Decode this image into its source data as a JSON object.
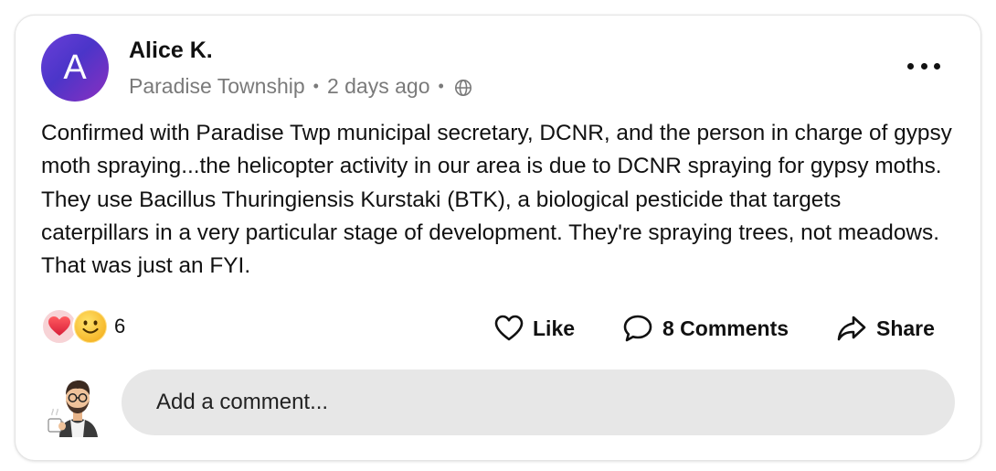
{
  "post": {
    "avatar_letter": "A",
    "author": "Alice K.",
    "location": "Paradise Township",
    "separator": "•",
    "time": "2 days ago",
    "visibility_icon": "globe-icon",
    "menu_icon": "more-horizontal-icon",
    "text": "Confirmed with Paradise Twp municipal secretary, DCNR, and the person in charge of gypsy moth spraying...the helicopter activity in our area is due to DCNR spraying for gypsy moths. They use Bacillus Thuringiensis Kurstaki (BTK), a biological pesticide that targets caterpillars in a very particular stage of development. They're spraying trees, not meadows. That was just an FYI."
  },
  "reactions": {
    "icons": [
      "heart-icon",
      "smile-icon"
    ],
    "count": "6"
  },
  "actions": {
    "like_label": "Like",
    "comments_label": "8 Comments",
    "share_label": "Share"
  },
  "comment": {
    "placeholder": "Add a comment..."
  },
  "colors": {
    "avatar_gradient_start": "#6a3fd8",
    "avatar_gradient_end": "#8b2fc0",
    "comment_box_bg": "#e7e7e7",
    "meta_text": "#7a7a7a"
  }
}
